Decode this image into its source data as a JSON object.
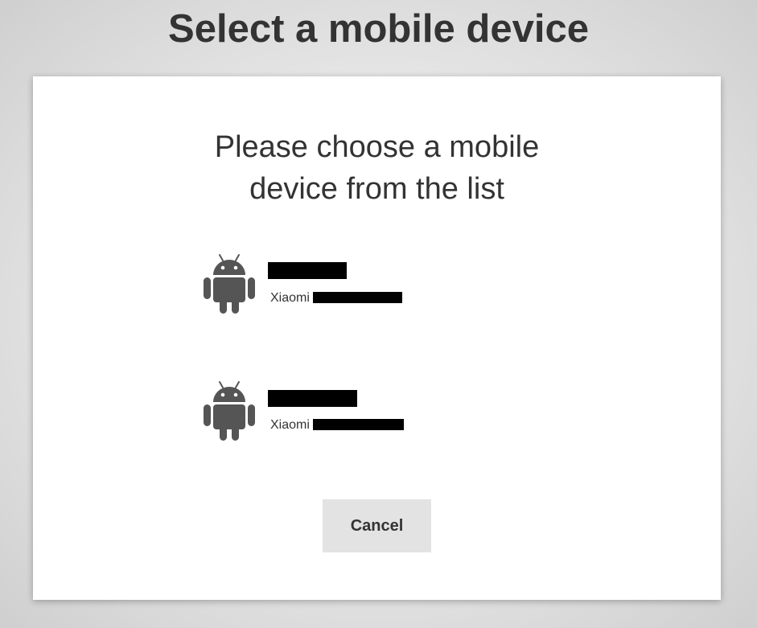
{
  "page": {
    "title": "Select a mobile device"
  },
  "dialog": {
    "prompt_line1": "Please choose a mobile",
    "prompt_line2": "device from the list",
    "devices": [
      {
        "icon": "android-icon",
        "manufacturer": "Xiaomi",
        "name_redacted": true,
        "model_redacted": true
      },
      {
        "icon": "android-icon",
        "manufacturer": "Xiaomi",
        "name_redacted": true,
        "model_redacted": true
      }
    ],
    "cancel_label": "Cancel"
  },
  "colors": {
    "text": "#333333",
    "icon": "#555555",
    "button_bg": "#e3e3e3",
    "redaction": "#000000"
  }
}
